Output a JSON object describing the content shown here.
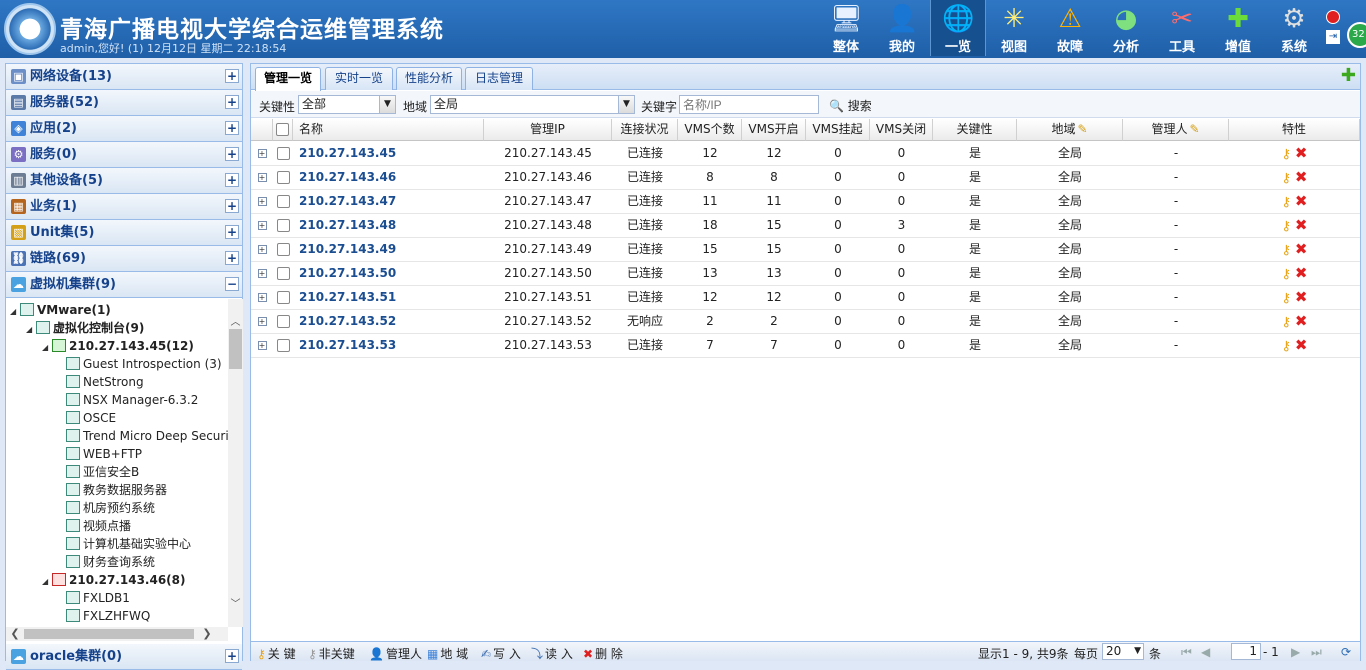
{
  "header": {
    "title": "青海广播电视大学综合运维管理系统",
    "user_line": "admin,您好! (1) 12月12日 星期二 22:18:54",
    "badge": "32",
    "nav": [
      {
        "label": "整体",
        "icon": "monitor-icon"
      },
      {
        "label": "我的",
        "icon": "user-icon"
      },
      {
        "label": "一览",
        "icon": "globe-icon",
        "active": true
      },
      {
        "label": "视图",
        "icon": "network-icon"
      },
      {
        "label": "故障",
        "icon": "warning-icon"
      },
      {
        "label": "分析",
        "icon": "pie-chart-icon"
      },
      {
        "label": "工具",
        "icon": "tools-icon"
      },
      {
        "label": "增值",
        "icon": "plus-icon"
      },
      {
        "label": "系统",
        "icon": "gear-icon"
      }
    ]
  },
  "sidebar": {
    "groups": [
      {
        "label": "网络设备(13)",
        "toggle": "+"
      },
      {
        "label": "服务器(52)",
        "toggle": "+"
      },
      {
        "label": "应用(2)",
        "toggle": "+"
      },
      {
        "label": "服务(0)",
        "toggle": "+"
      },
      {
        "label": "其他设备(5)",
        "toggle": "+"
      },
      {
        "label": "业务(1)",
        "toggle": "+"
      },
      {
        "label": "Unit集(5)",
        "toggle": "+"
      },
      {
        "label": "链路(69)",
        "toggle": "+"
      },
      {
        "label": "虚拟机集群(9)",
        "toggle": "−"
      }
    ],
    "tree": [
      {
        "label": "VMware(1)",
        "bold": true,
        "level": 0,
        "arrow": "◢"
      },
      {
        "label": "虚拟化控制台(9)",
        "bold": true,
        "level": 1,
        "arrow": "◢"
      },
      {
        "label": "210.27.143.45(12)",
        "bold": true,
        "level": 2,
        "arrow": "◢",
        "status": "ok"
      },
      {
        "label": "Guest Introspection (3)",
        "level": 3
      },
      {
        "label": "NetStrong",
        "level": 3
      },
      {
        "label": "NSX Manager-6.3.2",
        "level": 3
      },
      {
        "label": "OSCE",
        "level": 3
      },
      {
        "label": "Trend Micro Deep Security",
        "level": 3
      },
      {
        "label": "WEB+FTP",
        "level": 3
      },
      {
        "label": "亚信安全B",
        "level": 3
      },
      {
        "label": "教务数据服务器",
        "level": 3
      },
      {
        "label": "机房预约系统",
        "level": 3
      },
      {
        "label": "视频点播",
        "level": 3
      },
      {
        "label": "计算机基础实验中心",
        "level": 3
      },
      {
        "label": "财务查询系统",
        "level": 3
      },
      {
        "label": "210.27.143.46(8)",
        "bold": true,
        "level": 2,
        "arrow": "◢",
        "status": "err"
      },
      {
        "label": "FXLDB1",
        "level": 3
      },
      {
        "label": "FXLZHFWQ",
        "level": 3
      }
    ],
    "bottom_group": {
      "label": "oracle集群(0)",
      "toggle": "+"
    }
  },
  "tabs": [
    "管理一览",
    "实时一览",
    "性能分析",
    "日志管理"
  ],
  "filter": {
    "importance_label": "关键性",
    "importance_value": "全部",
    "region_label": "地域",
    "region_value": "全局",
    "keyword_label": "关键字",
    "keyword_placeholder": "名称/IP",
    "search_label": "搜索"
  },
  "table": {
    "columns": [
      "名称",
      "管理IP",
      "连接状况",
      "VMS个数",
      "VMS开启",
      "VMS挂起",
      "VMS关闭",
      "关键性",
      "地域",
      "管理人",
      "特性"
    ],
    "rows": [
      {
        "name": "210.27.143.45",
        "ip": "210.27.143.45",
        "status": "已连接",
        "vms": "12",
        "on": "12",
        "suspend": "0",
        "off": "0",
        "key": "是",
        "region": "全局",
        "admin": "-"
      },
      {
        "name": "210.27.143.46",
        "ip": "210.27.143.46",
        "status": "已连接",
        "vms": "8",
        "on": "8",
        "suspend": "0",
        "off": "0",
        "key": "是",
        "region": "全局",
        "admin": "-"
      },
      {
        "name": "210.27.143.47",
        "ip": "210.27.143.47",
        "status": "已连接",
        "vms": "11",
        "on": "11",
        "suspend": "0",
        "off": "0",
        "key": "是",
        "region": "全局",
        "admin": "-"
      },
      {
        "name": "210.27.143.48",
        "ip": "210.27.143.48",
        "status": "已连接",
        "vms": "18",
        "on": "15",
        "suspend": "0",
        "off": "3",
        "key": "是",
        "region": "全局",
        "admin": "-"
      },
      {
        "name": "210.27.143.49",
        "ip": "210.27.143.49",
        "status": "已连接",
        "vms": "15",
        "on": "15",
        "suspend": "0",
        "off": "0",
        "key": "是",
        "region": "全局",
        "admin": "-"
      },
      {
        "name": "210.27.143.50",
        "ip": "210.27.143.50",
        "status": "已连接",
        "vms": "13",
        "on": "13",
        "suspend": "0",
        "off": "0",
        "key": "是",
        "region": "全局",
        "admin": "-"
      },
      {
        "name": "210.27.143.51",
        "ip": "210.27.143.51",
        "status": "已连接",
        "vms": "12",
        "on": "12",
        "suspend": "0",
        "off": "0",
        "key": "是",
        "region": "全局",
        "admin": "-"
      },
      {
        "name": "210.27.143.52",
        "ip": "210.27.143.52",
        "status": "无响应",
        "vms": "2",
        "on": "2",
        "suspend": "0",
        "off": "0",
        "key": "是",
        "region": "全局",
        "admin": "-"
      },
      {
        "name": "210.27.143.53",
        "ip": "210.27.143.53",
        "status": "已连接",
        "vms": "7",
        "on": "7",
        "suspend": "0",
        "off": "0",
        "key": "是",
        "region": "全局",
        "admin": "-"
      }
    ]
  },
  "footer": {
    "actions": [
      "关 键",
      "非关键",
      "管理人",
      "地 域",
      "写 入",
      "读 入",
      "删 除"
    ],
    "display": "显示1 - 9, 共9条",
    "per_page_label": "每页",
    "per_page_value": "20",
    "per_page_unit": "条",
    "page_value": "1",
    "page_total": "- 1"
  },
  "colors": {
    "header": "#1f5fa8",
    "link": "#1b4d91",
    "accent_green": "#3ba81d"
  }
}
